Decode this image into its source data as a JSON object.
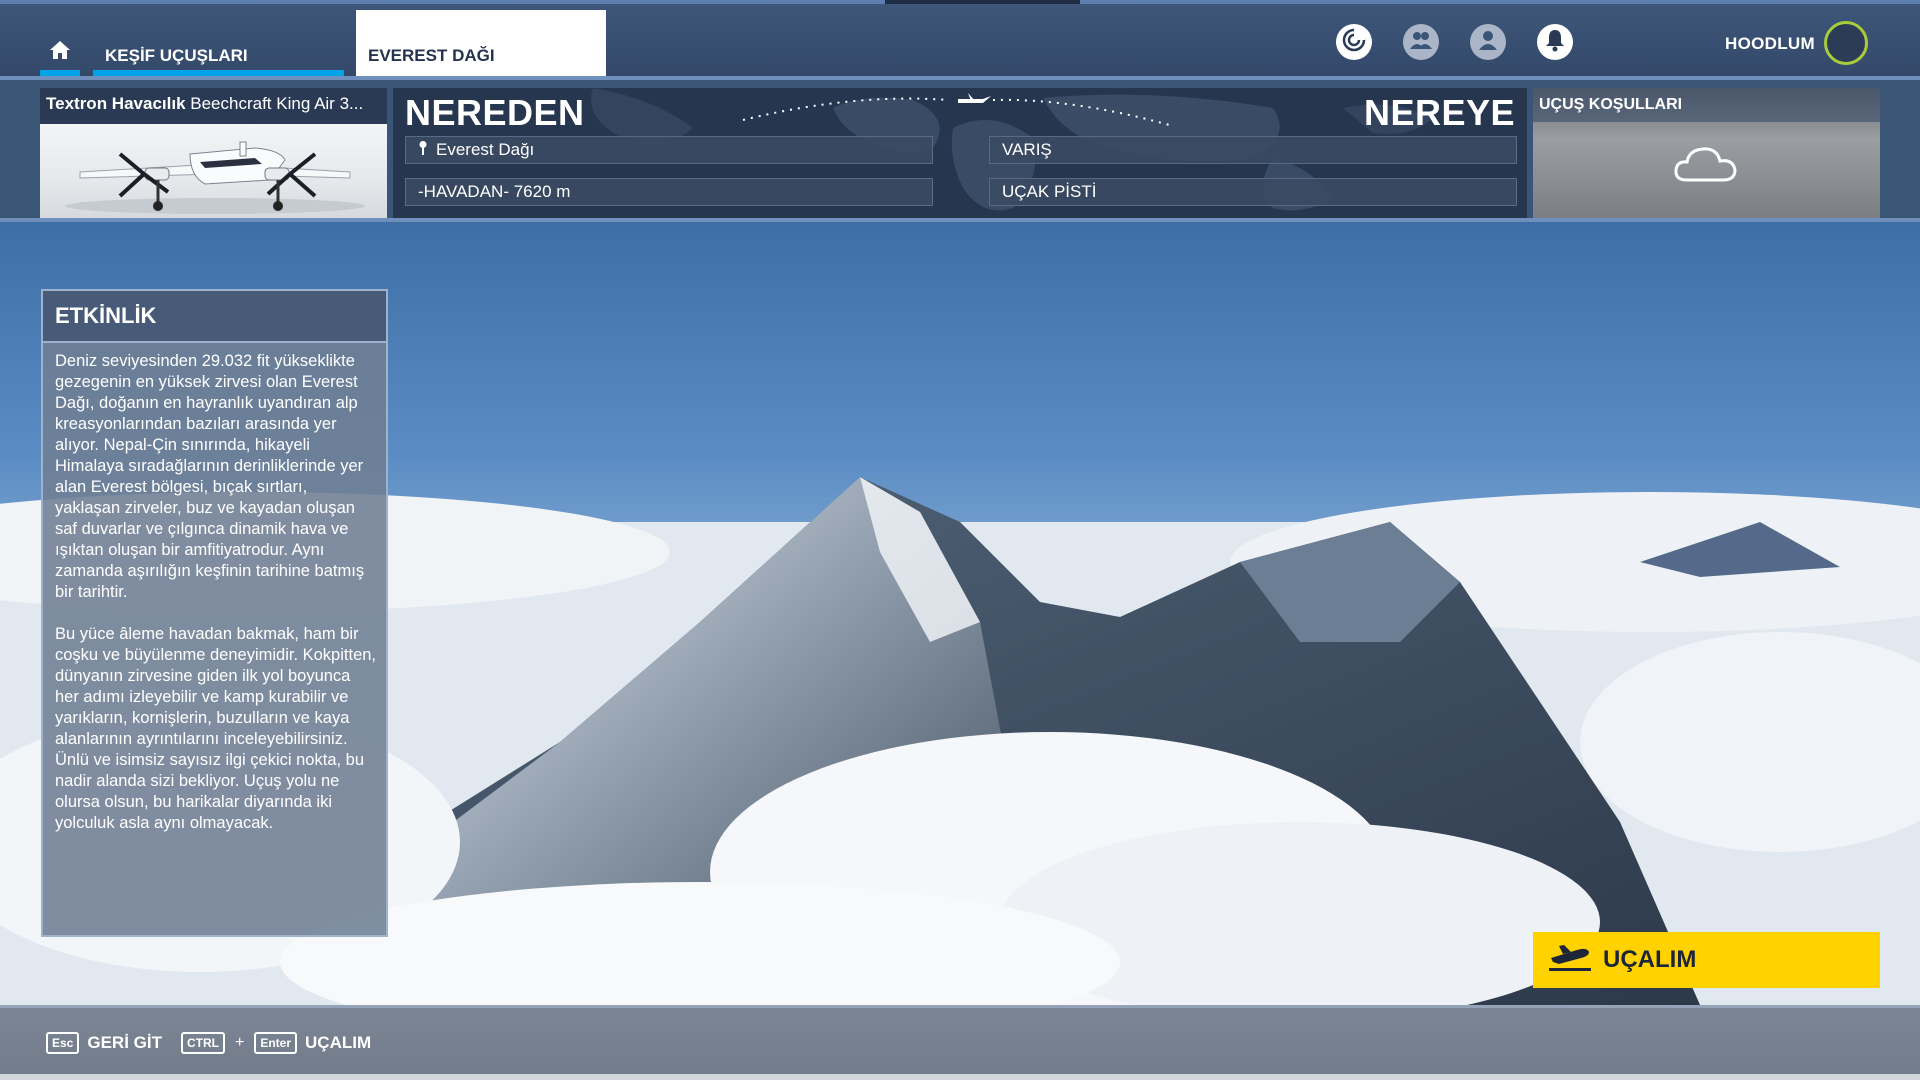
{
  "header": {
    "home_icon": "home-icon",
    "tabs": [
      {
        "label": "KEŞİF UÇUŞLARI"
      },
      {
        "label": "EVEREST DAĞI"
      }
    ],
    "tool_icons": [
      "activity-icon",
      "friends-icon",
      "profile-icon",
      "notifications-icon"
    ],
    "username": "HOODLUM"
  },
  "aircraft": {
    "manufacturer": "Textron Havacılık",
    "model": "Beechcraft King Air 3..."
  },
  "route": {
    "from_label": "NEREDEN",
    "to_label": "NEREYE",
    "departure": "Everest Dağı",
    "departure_state": "-HAVADAN- 7620 m",
    "arrival": "VARIŞ",
    "arrival_state": "UÇAK PİSTİ"
  },
  "conditions": {
    "title": "UÇUŞ KOŞULLARI",
    "weather_icon": "cloud-icon"
  },
  "activity": {
    "title": "ETKİNLİK",
    "paragraphs": [
      "Deniz seviyesinden 29.032 fit yükseklikte gezegenin en yüksek zirvesi olan Everest Dağı, doğanın en hayranlık uyandıran alp kreasyonlarından bazıları arasında yer alıyor. Nepal-Çin sınırında, hikayeli Himalaya sıradağlarının derinliklerinde yer alan Everest bölgesi, bıçak sırtları, yaklaşan zirveler, buz ve kayadan oluşan saf duvarlar ve çılgınca dinamik hava ve ışıktan oluşan bir amfitiyatrodur. Aynı zamanda aşırılığın keşfinin tarihine batmış bir tarihtir.",
      "Bu yüce âleme havadan bakmak, ham bir coşku ve büyülenme deneyimidir. Kokpitten, dünyanın zirvesine giden ilk yol boyunca her adımı izleyebilir ve kamp kurabilir ve yarıkların, kornişlerin, buzulların ve kaya alanlarının ayrıntılarını inceleyebilirsiniz. Ünlü ve isimsiz sayısız ilgi çekici nokta, bu nadir alanda sizi bekliyor. Uçuş yolu ne olursa olsun, bu harikalar diyarında iki yolculuk asla aynı olmayacak."
    ]
  },
  "fly_button": {
    "label": "UÇALIM",
    "icon": "takeoff-icon",
    "color": "#ffd200"
  },
  "footer": {
    "back_key": "Esc",
    "back_label": "GERİ GİT",
    "fly_key1": "CTRL",
    "fly_plus": "+",
    "fly_key2": "Enter",
    "fly_label": "UÇALIM"
  },
  "colors": {
    "accent": "#00a3e8",
    "avatar_ring": "#a8cc3c",
    "panel": "#3b5577"
  }
}
